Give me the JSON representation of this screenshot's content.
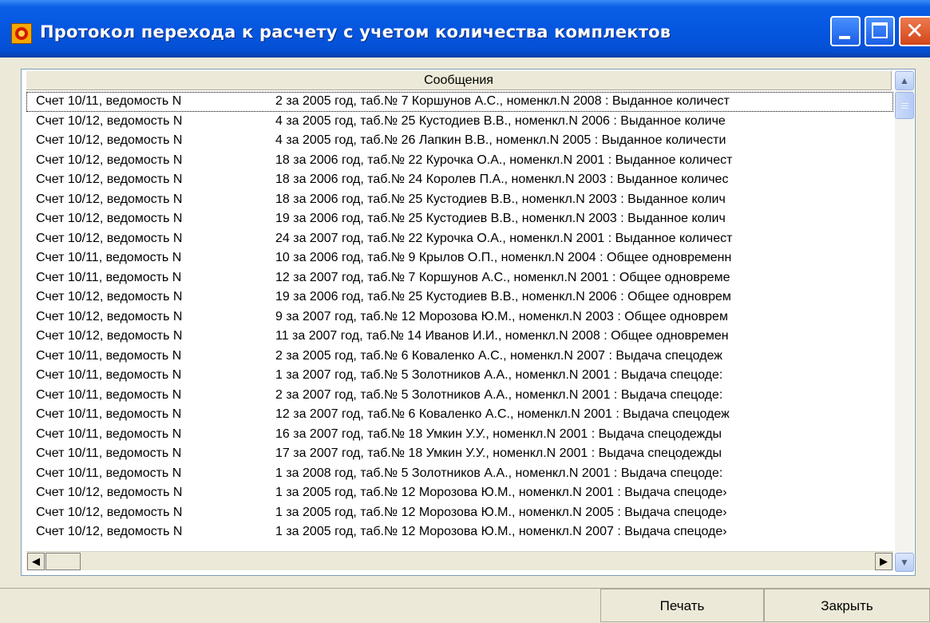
{
  "window": {
    "title": "Протокол перехода к расчету с учетом количества комплектов"
  },
  "table": {
    "header": "Сообщения",
    "rows": [
      {
        "c1": "Счет 10/11, ведомость N",
        "c2": "2 за 2005 год, таб.№ 7 Коршунов А.С., номенкл.N 2008 : Выданное количест"
      },
      {
        "c1": "Счет 10/12, ведомость N",
        "c2": "4 за 2005 год, таб.№ 25 Кустодиев В.В., номенкл.N 2006 : Выданное количе"
      },
      {
        "c1": "Счет 10/12, ведомость N",
        "c2": "4 за 2005 год, таб.№ 26 Лапкин В.В., номенкл.N 2005 : Выданное количести"
      },
      {
        "c1": "Счет 10/12, ведомость N",
        "c2": "18 за 2006 год, таб.№ 22 Курочка О.А., номенкл.N 2001 : Выданное количест"
      },
      {
        "c1": "Счет 10/12, ведомость N",
        "c2": "18 за 2006 год, таб.№ 24 Королев П.А., номенкл.N 2003 : Выданное количес"
      },
      {
        "c1": "Счет 10/12, ведомость N",
        "c2": "18 за 2006 год, таб.№ 25 Кустодиев В.В., номенкл.N 2003 : Выданное колич"
      },
      {
        "c1": "Счет 10/12, ведомость N",
        "c2": "19 за 2006 год, таб.№ 25 Кустодиев В.В., номенкл.N 2003 : Выданное колич"
      },
      {
        "c1": "Счет 10/12, ведомость N",
        "c2": "24 за 2007 год, таб.№ 22 Курочка О.А., номенкл.N 2001 : Выданное количест"
      },
      {
        "c1": "Счет 10/11, ведомость N",
        "c2": "10 за 2006 год, таб.№ 9 Крылов О.П., номенкл.N 2004 : Общее одновременн"
      },
      {
        "c1": "Счет 10/11, ведомость N",
        "c2": "12 за 2007 год, таб.№ 7 Коршунов А.С., номенкл.N 2001 : Общее одновреме"
      },
      {
        "c1": "Счет 10/12, ведомость N",
        "c2": "19 за 2006 год, таб.№ 25 Кустодиев В.В., номенкл.N 2006 : Общее одноврем"
      },
      {
        "c1": "Счет 10/12, ведомость N",
        "c2": "9 за 2007 год, таб.№ 12 Морозова Ю.М., номенкл.N 2003 : Общее одноврем"
      },
      {
        "c1": "Счет 10/12, ведомость N",
        "c2": "11 за 2007 год, таб.№ 14 Иванов И.И., номенкл.N 2008 : Общее одновремен"
      },
      {
        "c1": "Счет 10/11, ведомость N",
        "c2": "2 за 2005 год, таб.№ 6 Коваленко А.С., номенкл.N 2007 : Выдача спецодеж"
      },
      {
        "c1": "Счет 10/11, ведомость N",
        "c2": "1 за 2007 год, таб.№ 5 Золотников А.А., номенкл.N 2001 : Выдача спецоде:"
      },
      {
        "c1": "Счет 10/11, ведомость N",
        "c2": "2 за 2007 год, таб.№ 5 Золотников А.А., номенкл.N 2001 : Выдача спецоде:"
      },
      {
        "c1": "Счет 10/11, ведомость N",
        "c2": "12 за 2007 год, таб.№ 6 Коваленко А.С., номенкл.N 2001 : Выдача спецодеж"
      },
      {
        "c1": "Счет 10/11, ведомость N",
        "c2": "16 за 2007 год, таб.№ 18 Умкин У.У., номенкл.N 2001 : Выдача спецодежды"
      },
      {
        "c1": "Счет 10/11, ведомость N",
        "c2": "17 за 2007 год, таб.№ 18 Умкин У.У., номенкл.N 2001 : Выдача спецодежды"
      },
      {
        "c1": "Счет 10/11, ведомость N",
        "c2": "1 за 2008 год, таб.№ 5 Золотников А.А., номенкл.N 2001 : Выдача спецоде:"
      },
      {
        "c1": "Счет 10/12, ведомость N",
        "c2": "1 за 2005 год, таб.№ 12 Морозова Ю.М., номенкл.N 2001 : Выдача спецоде›"
      },
      {
        "c1": "Счет 10/12, ведомость N",
        "c2": "1 за 2005 год, таб.№ 12 Морозова Ю.М., номенкл.N 2005 : Выдача спецоде›"
      },
      {
        "c1": "Счет 10/12, ведомость N",
        "c2": "1 за 2005 год, таб.№ 12 Морозова Ю.М., номенкл.N 2007 : Выдача спецоде›"
      }
    ]
  },
  "buttons": {
    "print": "Печать",
    "close": "Закрыть"
  },
  "icons": {
    "app": "app-icon",
    "minimize": "minimize-icon",
    "maximize": "maximize-icon",
    "close": "close-icon",
    "scroll_up": "scroll-up-arrow-icon",
    "scroll_down": "scroll-down-arrow-icon",
    "scroll_left": "scroll-left-arrow-icon",
    "scroll_right": "scroll-right-arrow-icon"
  }
}
